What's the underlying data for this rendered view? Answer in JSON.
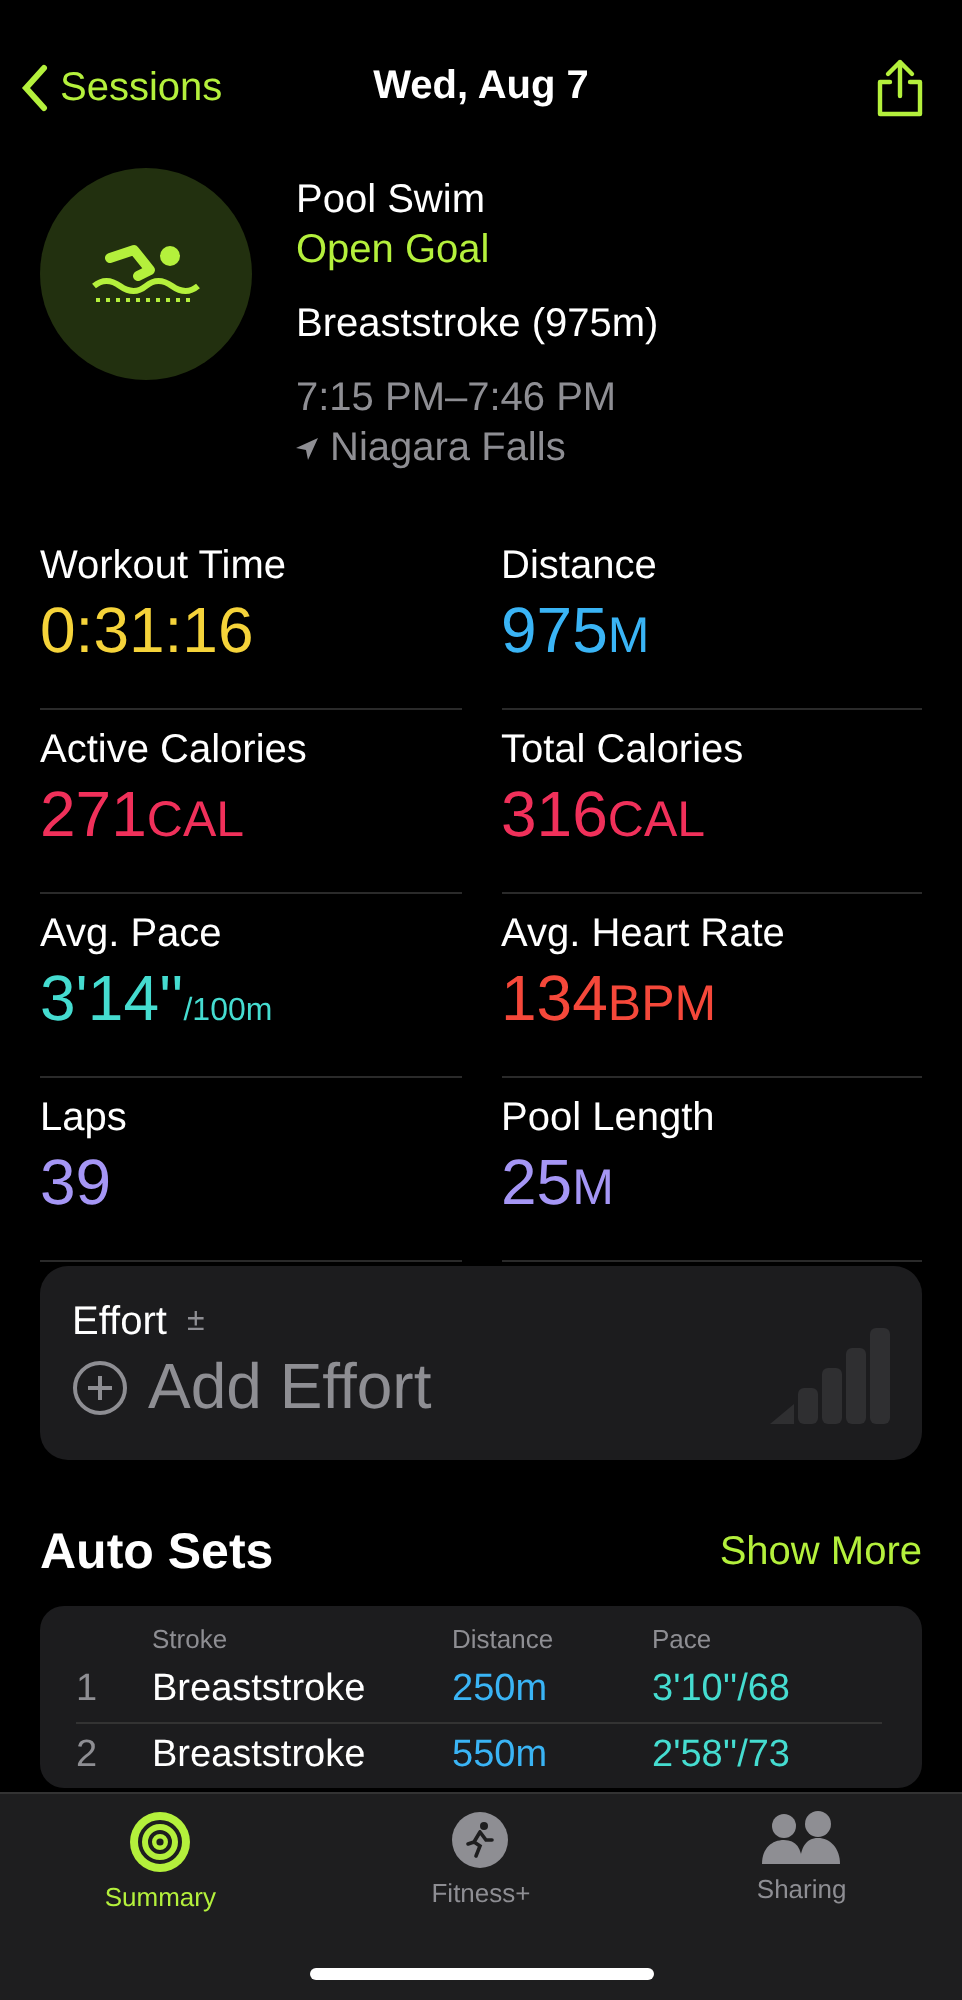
{
  "nav": {
    "back": "Sessions",
    "title": "Wed, Aug 7"
  },
  "workout": {
    "name": "Pool Swim",
    "goal": "Open Goal",
    "stroke": "Breaststroke (975m)",
    "time": "7:15 PM–7:46 PM",
    "location": "Niagara Falls"
  },
  "metrics": [
    {
      "label": "Workout Time",
      "value": "0:31:16",
      "color": "#f5d33a"
    },
    {
      "label": "Distance",
      "value": "975",
      "unit": "M",
      "color": "#3ab4f5"
    },
    {
      "label": "Active Calories",
      "value": "271",
      "unit": "CAL",
      "color": "#f0305a"
    },
    {
      "label": "Total Calories",
      "value": "316",
      "unit": "CAL",
      "color": "#f0305a"
    },
    {
      "label": "Avg. Pace",
      "value": "3'14''",
      "unit": "/100m",
      "color": "#45dcd0"
    },
    {
      "label": "Avg. Heart Rate",
      "value": "134",
      "unit": "BPM",
      "color": "#f5483a"
    },
    {
      "label": "Laps",
      "value": "39",
      "color": "#a596f5"
    },
    {
      "label": "Pool Length",
      "value": "25",
      "unit": "M",
      "color": "#a596f5"
    }
  ],
  "effort": {
    "label": "Effort",
    "sign": "±",
    "action": "Add Effort"
  },
  "auto_sets": {
    "title": "Auto Sets",
    "more": "Show More",
    "columns": [
      "Stroke",
      "Distance",
      "Pace"
    ],
    "rows": [
      {
        "index": "1",
        "stroke": "Breaststroke",
        "distance": "250m",
        "pace": "3'10''/68"
      },
      {
        "index": "2",
        "stroke": "Breaststroke",
        "distance": "550m",
        "pace": "2'58''/73"
      }
    ]
  },
  "tab_bar": [
    {
      "label": "Summary",
      "kind": "rings",
      "selected": true
    },
    {
      "label": "Fitness+",
      "kind": "runner",
      "selected": false
    },
    {
      "label": "Sharing",
      "kind": "people",
      "selected": false
    }
  ]
}
